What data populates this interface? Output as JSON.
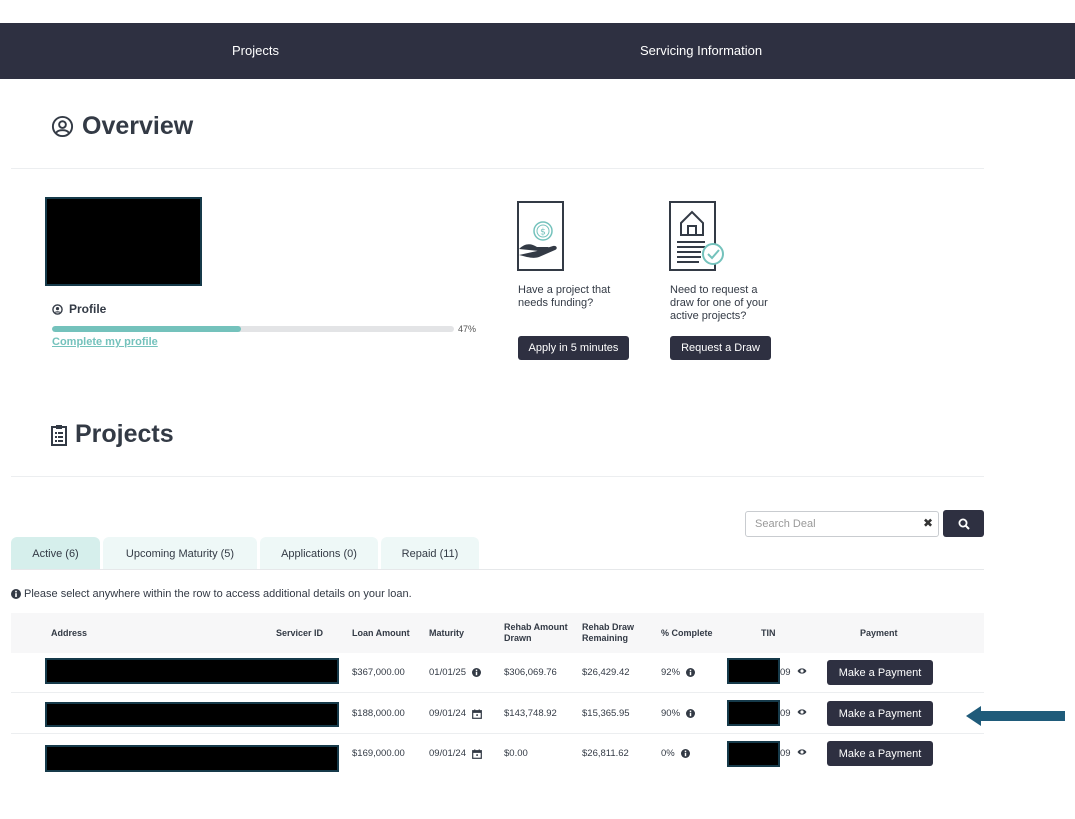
{
  "nav": {
    "projects": "Projects",
    "servicing": "Servicing Information"
  },
  "overview": {
    "title": "Overview",
    "profile_label": "Profile",
    "progress_fraction": 0.47,
    "progress_pct": "47%",
    "complete_link": "Complete my profile"
  },
  "cards": {
    "funding": {
      "text": "Have a project that needs funding?",
      "button": "Apply in 5 minutes",
      "icon": "hand-dollar-icon"
    },
    "draw": {
      "text": "Need to request a draw for one of your active projects?",
      "button": "Request a Draw",
      "icon": "house-document-check-icon"
    }
  },
  "projects": {
    "title": "Projects",
    "search_placeholder": "Search Deal",
    "tabs": [
      "Active (6)",
      "Upcoming Maturity (5)",
      "Applications (0)",
      "Repaid (11)"
    ],
    "note": "Please select anywhere within the row to access additional details on your loan.",
    "headers": {
      "address": "Address",
      "servicer_id": "Servicer ID",
      "loan_amount": "Loan Amount",
      "maturity": "Maturity",
      "rehab_drawn": "Rehab Amount Drawn",
      "rehab_remaining": "Rehab Draw Remaining",
      "pct_complete": "% Complete",
      "tin": "TIN",
      "payment": "Payment"
    },
    "rows": [
      {
        "loan_amount": "$367,000.00",
        "maturity": "01/01/25",
        "maturity_icon": "info-icon",
        "rehab_drawn": "$306,069.76",
        "rehab_remaining": "$26,429.42",
        "pct_complete": "92%",
        "tin_tail": "09",
        "pay": "Make a Payment"
      },
      {
        "loan_amount": "$188,000.00",
        "maturity": "09/01/24",
        "maturity_icon": "calendar-icon",
        "rehab_drawn": "$143,748.92",
        "rehab_remaining": "$15,365.95",
        "pct_complete": "90%",
        "tin_tail": "09",
        "pay": "Make a Payment"
      },
      {
        "loan_amount": "$169,000.00",
        "maturity": "09/01/24",
        "maturity_icon": "calendar-icon",
        "rehab_drawn": "$0.00",
        "rehab_remaining": "$26,811.62",
        "pct_complete": "0%",
        "tin_tail": "09",
        "pay": "Make a Payment"
      }
    ]
  },
  "colors": {
    "nav_bg": "#2e3041",
    "accent": "#74c2bc",
    "arrow": "#1f5b7a"
  }
}
